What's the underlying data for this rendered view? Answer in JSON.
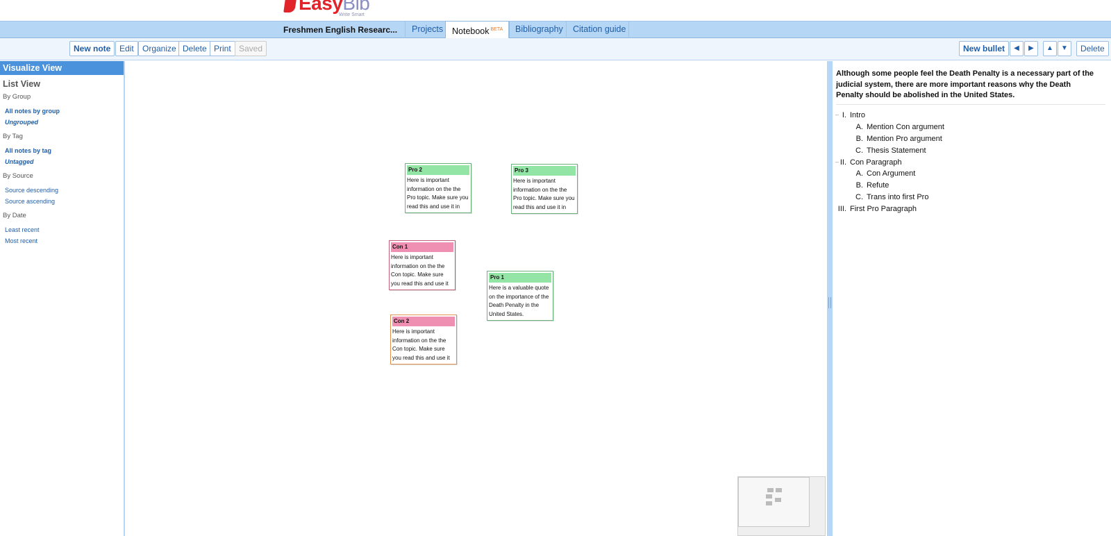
{
  "header": {
    "logo_text_main": "Easy",
    "logo_text_accent": "Bib",
    "logo_tagline": "Write Smart"
  },
  "tabbar": {
    "project_title": "Freshmen English Researc...",
    "tabs": [
      "Projects",
      "Notebook",
      "Bibliography",
      "Citation guide"
    ],
    "active_tab": "Notebook",
    "beta_label": "BETA"
  },
  "toolbar": {
    "new_note": "New note",
    "edit": "Edit",
    "organize": "Organize",
    "delete": "Delete",
    "print": "Print",
    "saved": "Saved",
    "new_bullet": "New bullet",
    "outdent": "◀",
    "indent": "▶",
    "move_up": "▲",
    "move_down": "▼",
    "delete_bullet": "Delete"
  },
  "sidebar": {
    "visualize_view": "Visualize View",
    "list_view": "List View",
    "by_group": "By Group",
    "all_notes_by_group": "All notes by group",
    "ungrouped": "Ungrouped",
    "by_tag": "By Tag",
    "all_notes_by_tag": "All notes by tag",
    "untagged": "Untagged",
    "by_source": "By Source",
    "source_descending": "Source descending",
    "source_ascending": "Source ascending",
    "by_date": "By Date",
    "least_recent": "Least recent",
    "most_recent": "Most recent"
  },
  "notes": [
    {
      "title": "Pro 2",
      "body": "Here is important information on the the Pro topic. Make sure you read this and use it in",
      "kind": "pro"
    },
    {
      "title": "Pro 3",
      "body": "Here is important information on the the Pro topic. Make sure you read this and use it in",
      "kind": "pro"
    },
    {
      "title": "Con 1",
      "body": "Here is important information on the the Con topic. Make sure you read this and use it",
      "kind": "con"
    },
    {
      "title": "Pro 1",
      "body": "Here is a valuable quote on the importance of the Death Penalty in the United States.",
      "kind": "pro"
    },
    {
      "title": "Con 2",
      "body": "Here is important information on the the Con topic. Make sure you read this and use it",
      "kind": "con"
    }
  ],
  "outline": {
    "thesis": "Although some people feel the Death Penalty is a necessary part of the judicial system, there are more important reasons why the Death Penalty should be abolished in the United States.",
    "items": [
      {
        "marker": "I.",
        "text": "Intro"
      },
      {
        "marker": "A.",
        "text": "Mention Con argument"
      },
      {
        "marker": "B.",
        "text": "Mention Pro argument"
      },
      {
        "marker": "C.",
        "text": "Thesis Statement"
      },
      {
        "marker": "II.",
        "text": "Con Paragraph"
      },
      {
        "marker": "A.",
        "text": "Con Argument"
      },
      {
        "marker": "B.",
        "text": "Refute"
      },
      {
        "marker": "C.",
        "text": "Trans into first Pro"
      },
      {
        "marker": "III.",
        "text": "First Pro Paragraph"
      }
    ]
  },
  "colors": {
    "tabbar_bg": "#b5d6f5",
    "visualize_view_bg": "#4b92dd",
    "pro_note_header": "#93e5a6",
    "con_note_header": "#ef8fb2",
    "logo_red": "#e0242a"
  }
}
